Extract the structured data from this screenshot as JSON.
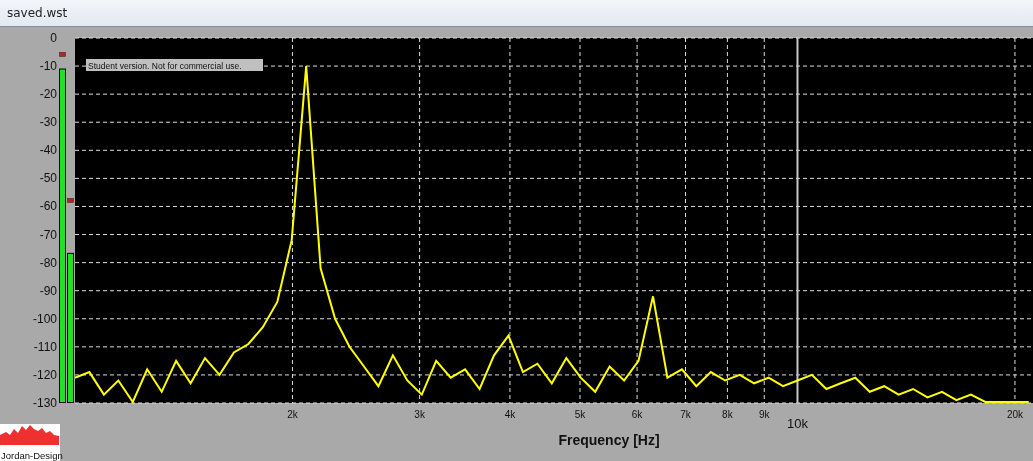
{
  "window": {
    "title": "saved.wst"
  },
  "meters": [
    {
      "level": 0.915,
      "peak": {
        "level": 0.955
      }
    },
    {
      "level": 0.41,
      "peak": {
        "level": 0.555
      }
    }
  ],
  "chart": {
    "notice": "Student version. Not for commercial use.",
    "logo_text": "Jordan-Design",
    "x_tick_labels": [
      "2k",
      "3k",
      "4k",
      "5k",
      "6k",
      "7k",
      "8k",
      "9k",
      "20k"
    ],
    "cursor_label": "10k",
    "chart_data": {
      "type": "line",
      "xlabel": "Frequency [Hz]",
      "grid": true,
      "categories": [
        null,
        null,
        null,
        null,
        null,
        null,
        null,
        null,
        null,
        null,
        null,
        null,
        null,
        null,
        null,
        null,
        null,
        null,
        null,
        null,
        null,
        null,
        null,
        null,
        null,
        null,
        null,
        null,
        null,
        null,
        null,
        null,
        null,
        null,
        null,
        null,
        null,
        null,
        null,
        null,
        null,
        null,
        null,
        null,
        null,
        null,
        null,
        null,
        null,
        null,
        null,
        null,
        null,
        null,
        null,
        null,
        null,
        null,
        null,
        null,
        null,
        null,
        null,
        null,
        null,
        null,
        null
      ],
      "series": [
        {
          "color": "#ffff00",
          "values": [
            -121,
            -119,
            -127,
            -122,
            -130,
            -118,
            -126,
            -115,
            -123,
            -114,
            -120,
            -112,
            -109,
            -103,
            -94,
            -72,
            -10,
            -82,
            -100,
            -110,
            -117,
            -124,
            -113,
            -122,
            -127,
            -115,
            -121,
            -118,
            -125,
            -113,
            -106,
            -119,
            -116,
            -123,
            -114,
            -121,
            -126,
            -117,
            -122,
            -115,
            -92,
            -121,
            -118,
            -124,
            -119,
            -122,
            -120,
            -123,
            -121,
            -124,
            -122,
            -120,
            -125,
            -123,
            -121,
            -126,
            -124,
            -127,
            -125,
            -128,
            -126,
            -129,
            -127,
            -130,
            -130,
            -130,
            -130
          ]
        }
      ],
      "ylim": [
        -130,
        0
      ],
      "yticks": [
        0,
        -10,
        -20,
        -30,
        -40,
        -50,
        -60,
        -70,
        -80,
        -90,
        -100,
        -110,
        -120,
        -130
      ]
    }
  }
}
